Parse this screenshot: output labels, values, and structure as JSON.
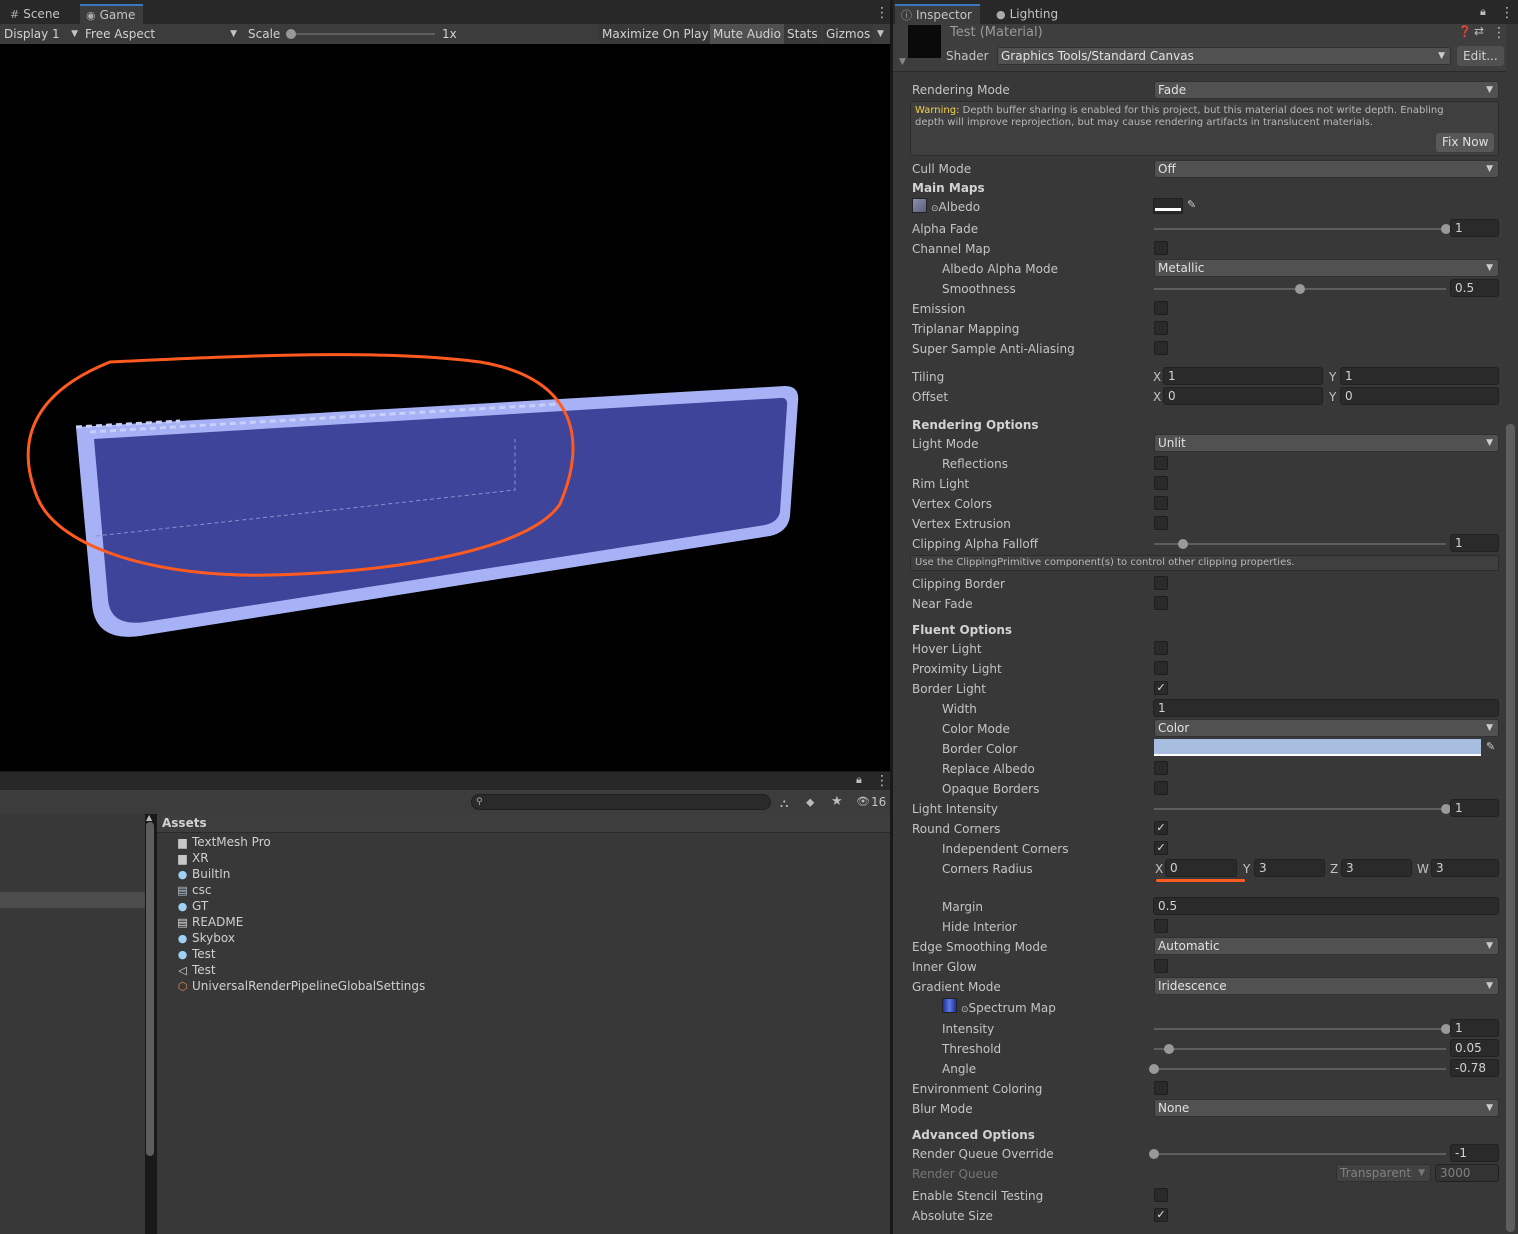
{
  "game_panel": {
    "tabs": [
      {
        "label": "Scene",
        "icon": "grid-icon"
      },
      {
        "label": "Game",
        "icon": "gamepad-icon"
      }
    ],
    "toolbar": {
      "display": "Display 1",
      "aspect": "Free Aspect",
      "scale_label": "Scale",
      "scale_value": "1x",
      "buttons": [
        "Maximize On Play",
        "Mute Audio",
        "Stats",
        "Gizmos"
      ]
    }
  },
  "project_panel": {
    "hidden_count": "16",
    "breadcrumb": "Assets",
    "assets": [
      {
        "name": "TextMesh Pro",
        "icon": "folder-icon"
      },
      {
        "name": "XR",
        "icon": "folder-icon"
      },
      {
        "name": "BuiltIn",
        "icon": "material-icon"
      },
      {
        "name": "csc",
        "icon": "script-icon"
      },
      {
        "name": "GT",
        "icon": "material-icon"
      },
      {
        "name": "README",
        "icon": "document-icon"
      },
      {
        "name": "Skybox",
        "icon": "material-icon"
      },
      {
        "name": "Test",
        "icon": "material-icon"
      },
      {
        "name": "Test",
        "icon": "unity-prefab-icon"
      },
      {
        "name": "UniversalRenderPipelineGlobalSettings",
        "icon": "settings-asset-icon"
      }
    ]
  },
  "inspector": {
    "tabs": [
      {
        "label": "Inspector",
        "icon": "info-icon"
      },
      {
        "label": "Lighting",
        "icon": "bulb-icon"
      }
    ],
    "material_title": "Test (Material)",
    "shader_label": "Shader",
    "shader_value": "Graphics Tools/Standard Canvas",
    "edit_button": "Edit...",
    "rendering_mode": {
      "label": "Rendering Mode",
      "value": "Fade"
    },
    "warning": {
      "prefix": "Warning:",
      "text": " Depth buffer sharing is enabled for this project, but this material does not write depth. Enabling depth will improve reprojection, but may cause rendering artifacts in translucent materials.",
      "button": "Fix Now"
    },
    "cull_mode": {
      "label": "Cull Mode",
      "value": "Off"
    },
    "main_maps": "Main Maps",
    "albedo": "Albedo",
    "alpha_fade": {
      "label": "Alpha Fade",
      "value": "1"
    },
    "channel_map": "Channel Map",
    "albedo_alpha_mode": {
      "label": "Albedo Alpha Mode",
      "value": "Metallic"
    },
    "smoothness": {
      "label": "Smoothness",
      "value": "0.5"
    },
    "emission": "Emission",
    "triplanar": "Triplanar Mapping",
    "ssaa": "Super Sample Anti-Aliasing",
    "tiling": {
      "label": "Tiling",
      "x": "1",
      "y": "1"
    },
    "offset": {
      "label": "Offset",
      "x": "0",
      "y": "0"
    },
    "rendering_options": "Rendering Options",
    "light_mode": {
      "label": "Light Mode",
      "value": "Unlit"
    },
    "reflections": "Reflections",
    "rim_light": "Rim Light",
    "vertex_colors": "Vertex Colors",
    "vertex_extrusion": "Vertex Extrusion",
    "clipping_alpha_falloff": {
      "label": "Clipping Alpha Falloff",
      "value": "1"
    },
    "clipping_info": "Use the ClippingPrimitive component(s) to control other clipping properties.",
    "clipping_border": "Clipping Border",
    "near_fade": "Near Fade",
    "fluent_options": "Fluent Options",
    "hover_light": "Hover Light",
    "proximity_light": "Proximity Light",
    "border_light": "Border Light",
    "width": {
      "label": "Width",
      "value": "1"
    },
    "color_mode": {
      "label": "Color Mode",
      "value": "Color"
    },
    "border_color": {
      "label": "Border Color",
      "color": "#a6bde0"
    },
    "replace_albedo": "Replace Albedo",
    "opaque_borders": "Opaque Borders",
    "light_intensity": {
      "label": "Light Intensity",
      "value": "1"
    },
    "round_corners": "Round Corners",
    "independent_corners": "Independent Corners",
    "corners_radius": {
      "label": "Corners Radius",
      "x": "0",
      "y": "3",
      "z": "3",
      "w": "3"
    },
    "margin": {
      "label": "Margin",
      "value": "0.5"
    },
    "hide_interior": "Hide Interior",
    "edge_smoothing": {
      "label": "Edge Smoothing Mode",
      "value": "Automatic"
    },
    "inner_glow": "Inner Glow",
    "gradient_mode": {
      "label": "Gradient Mode",
      "value": "Iridescence"
    },
    "spectrum_map": "Spectrum Map",
    "intensity": {
      "label": "Intensity",
      "value": "1"
    },
    "threshold": {
      "label": "Threshold",
      "value": "0.05"
    },
    "angle": {
      "label": "Angle",
      "value": "-0.78"
    },
    "environment_coloring": "Environment Coloring",
    "blur_mode": {
      "label": "Blur Mode",
      "value": "None"
    },
    "advanced_options": "Advanced Options",
    "render_queue_override": {
      "label": "Render Queue Override",
      "value": "-1"
    },
    "render_queue": {
      "label": "Render Queue",
      "mode": "Transparent",
      "value": "3000"
    },
    "stencil": "Enable Stencil Testing",
    "absolute_size": "Absolute Size",
    "checks": {
      "channel_map": false,
      "emission": false,
      "triplanar": false,
      "ssaa": false,
      "reflections": false,
      "rim_light": false,
      "vertex_colors": false,
      "vertex_extrusion": false,
      "clipping_border": false,
      "near_fade": false,
      "hover_light": false,
      "proximity_light": false,
      "border_light": true,
      "replace_albedo": false,
      "opaque_borders": false,
      "round_corners": true,
      "independent_corners": true,
      "hide_interior": false,
      "inner_glow": false,
      "environment_coloring": false,
      "stencil": false,
      "absolute_size": true
    },
    "sliders": {
      "alpha_fade": 1.0,
      "smoothness": 0.5,
      "clipping_alpha_falloff": 0.1,
      "light_intensity": 1.0,
      "intensity": 1.0,
      "threshold": 0.05,
      "angle": 0.0,
      "render_queue_override": 0.0
    }
  },
  "colors": {
    "accent": "#3a79bb",
    "annotation": "#ff5a1f",
    "panel_fill": "#3d4499",
    "panel_border": "#a6b2f5"
  }
}
